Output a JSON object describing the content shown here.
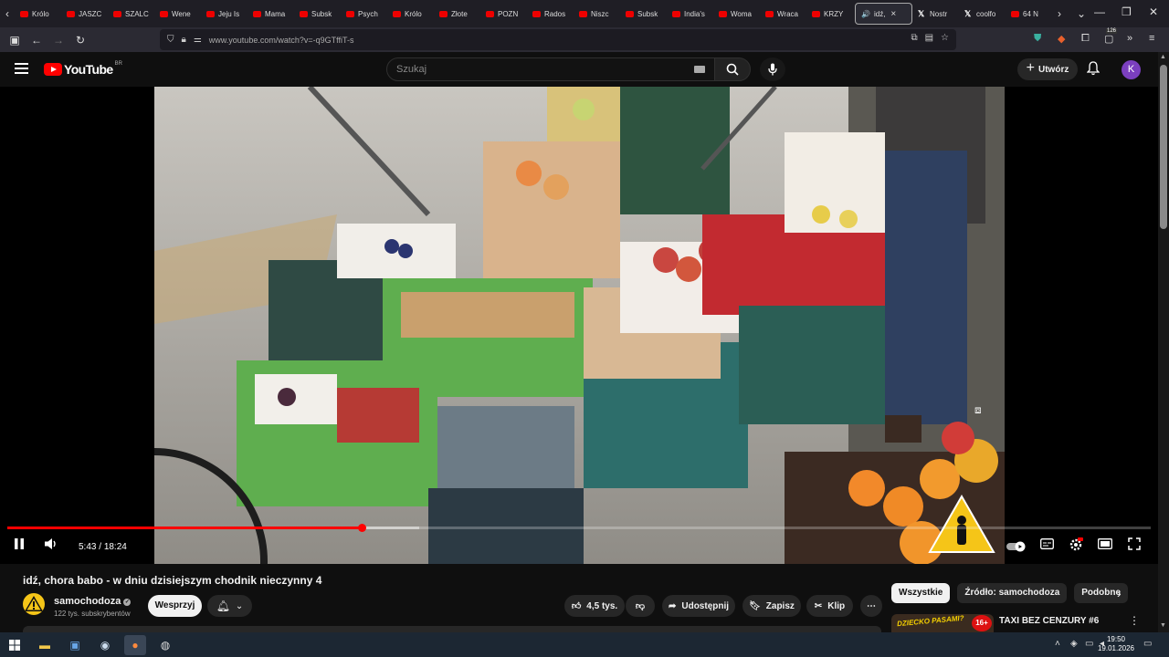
{
  "browser": {
    "tabs": [
      {
        "label": "Królo",
        "kind": "yt"
      },
      {
        "label": "JASZC",
        "kind": "yt"
      },
      {
        "label": "SZALC",
        "kind": "yt"
      },
      {
        "label": "Wene",
        "kind": "yt"
      },
      {
        "label": "Jeju Is",
        "kind": "yt"
      },
      {
        "label": "Mama",
        "kind": "yt"
      },
      {
        "label": "Subsk",
        "kind": "yt"
      },
      {
        "label": "Psych",
        "kind": "yt"
      },
      {
        "label": "Królo",
        "kind": "yt"
      },
      {
        "label": "Złote",
        "kind": "yt"
      },
      {
        "label": "POZN",
        "kind": "yt"
      },
      {
        "label": "Rados",
        "kind": "yt"
      },
      {
        "label": "Niszc",
        "kind": "yt"
      },
      {
        "label": "Subsk",
        "kind": "yt"
      },
      {
        "label": "India's",
        "kind": "yt"
      },
      {
        "label": "Woma",
        "kind": "yt"
      },
      {
        "label": "Wraca",
        "kind": "yt"
      },
      {
        "label": "KRZY",
        "kind": "yt"
      }
    ],
    "active_tab": {
      "label": "idź,",
      "close": "×"
    },
    "tabs_after": [
      {
        "label": "Nostr",
        "kind": "x"
      },
      {
        "label": "coolfo",
        "kind": "x"
      },
      {
        "label": "64 N",
        "kind": "yt"
      }
    ],
    "url": "www.youtube.com/watch?v=-q9GTffiT-s",
    "extension_badge": "126"
  },
  "youtube": {
    "logo_text": "YouTube",
    "logo_country": "BR",
    "search_placeholder": "Szukaj",
    "create_label": "Utwórz",
    "avatar_letter": "K"
  },
  "player": {
    "time_current": "5:43",
    "time_separator": " / ",
    "time_total": "18:24",
    "progress_fraction": 0.31,
    "buffer_fraction": 0.36
  },
  "video": {
    "title": "idź, chora babo - w dniu dzisiejszym chodnik nieczynny 4",
    "channel_name": "samochodoza",
    "channel_subs": "122 tys. subskrybentów",
    "support_label": "Wesprzyj",
    "like_count": "4,5 tys.",
    "share_label": "Udostępnij",
    "save_label": "Zapisz",
    "clip_label": "Klip"
  },
  "sidebar": {
    "chips": [
      "Wszystkie",
      "Źródło: samochodoza",
      "Podobne"
    ],
    "rec_title": "TAXI BEZ CENZURY #6",
    "rec_thumb_text": "DZIECKO PASAMI?",
    "rec_thumb_badge": "16+"
  },
  "taskbar": {
    "time": "19:50",
    "date": "19.01.2026"
  },
  "colors": {
    "accent": "#ff0000",
    "avatar": "#7b3fbf",
    "background": "#0f0f0f"
  }
}
